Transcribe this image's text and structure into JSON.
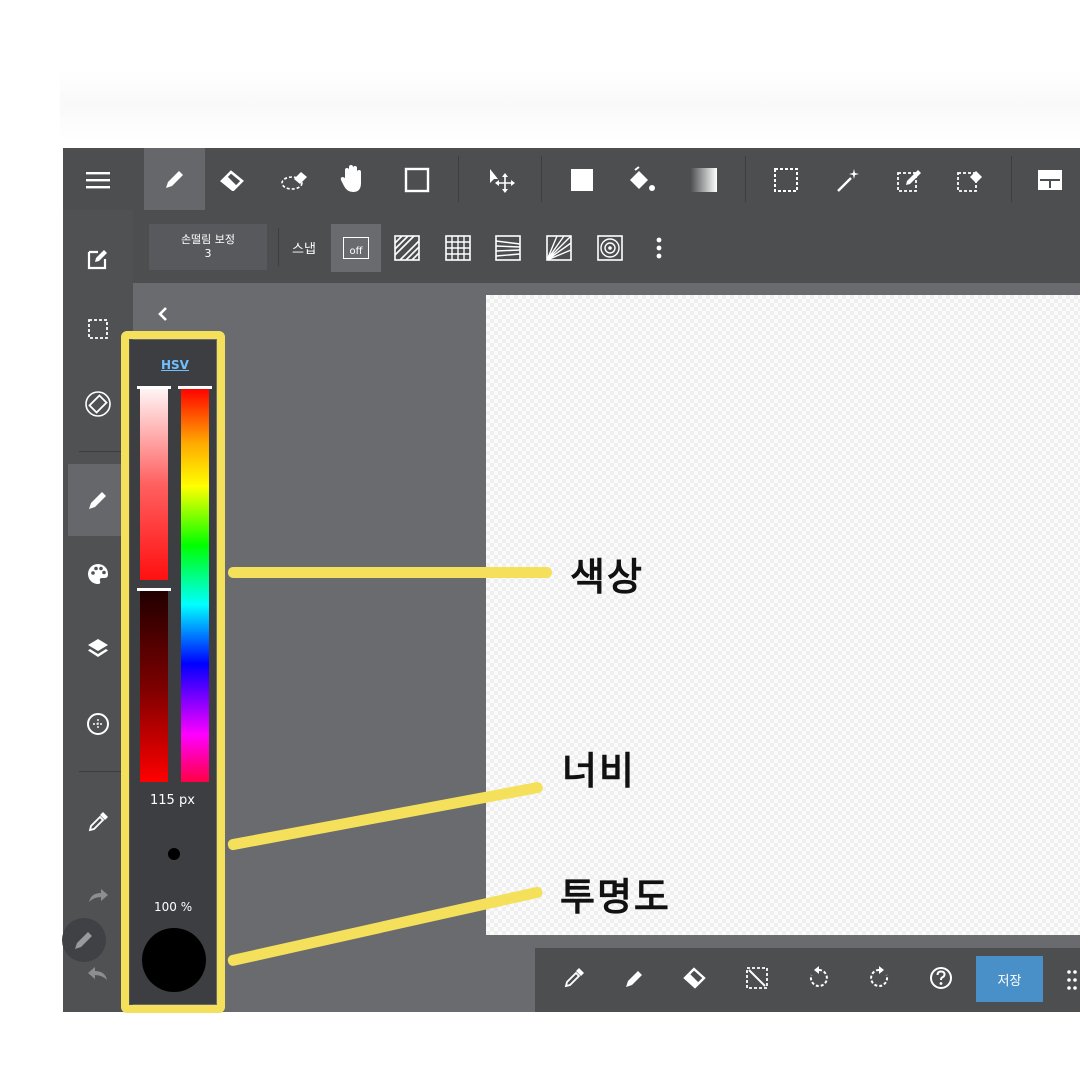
{
  "toolbar": {
    "tools": [
      "menu-icon",
      "pen-icon",
      "eraser-icon",
      "dashed-eraser-icon",
      "hand-icon",
      "square-outline-icon",
      "move-icon",
      "fill-square-icon",
      "bucket-icon",
      "gradient-icon",
      "selection-icon",
      "magic-wand-icon",
      "select-pen-icon",
      "select-eraser-icon",
      "layout-icon"
    ]
  },
  "secondbar": {
    "stabilizer_label": "손떨림 보정",
    "stabilizer_value": "3",
    "snap_label": "스냅",
    "snap_off": "off"
  },
  "panel": {
    "mode_label": "HSV",
    "width_value": "115 px",
    "opacity_value": "100 %"
  },
  "bottombar": {
    "save_label": "저장"
  },
  "annotations": {
    "color": "색상",
    "width": "너비",
    "opacity": "투명도"
  },
  "colors": {
    "highlight": "#f5e05c",
    "save_button": "#4a90c8",
    "current_color": "#000000"
  }
}
